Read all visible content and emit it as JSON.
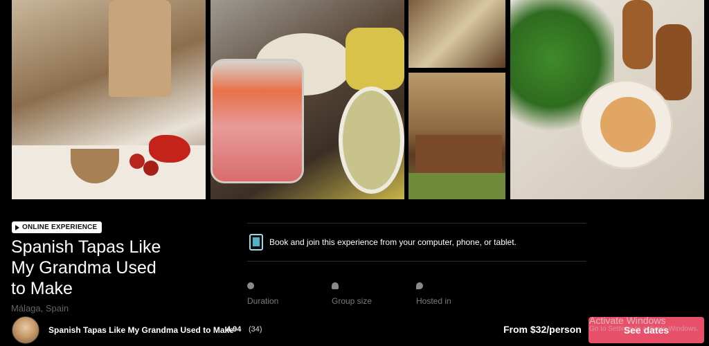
{
  "badge": {
    "label": "ONLINE EXPERIENCE"
  },
  "experience": {
    "title_lines": [
      "Spanish Tapas Like",
      "My Grandma Used",
      "to Make"
    ],
    "location": "Málaga, Spain"
  },
  "info": {
    "device_text": "Book and join this experience from your computer, phone, or tablet."
  },
  "stats": [
    {
      "label": "Duration",
      "icon": "clock-icon"
    },
    {
      "label": "Group size",
      "icon": "group-icon"
    },
    {
      "label": "Hosted in",
      "icon": "chat-icon"
    }
  ],
  "bottom_bar": {
    "title": "Spanish Tapas Like My Grandma Used to Make",
    "rating": "4.94",
    "reviews": "(34)",
    "price": "From $32/person",
    "cta": "See dates"
  },
  "watermark": {
    "line1": "Activate Windows",
    "line2": "Go to Settings to activate Windows."
  },
  "colors": {
    "background": "#000000",
    "cta": "#e8506a",
    "badge_bg": "#ffffff"
  }
}
